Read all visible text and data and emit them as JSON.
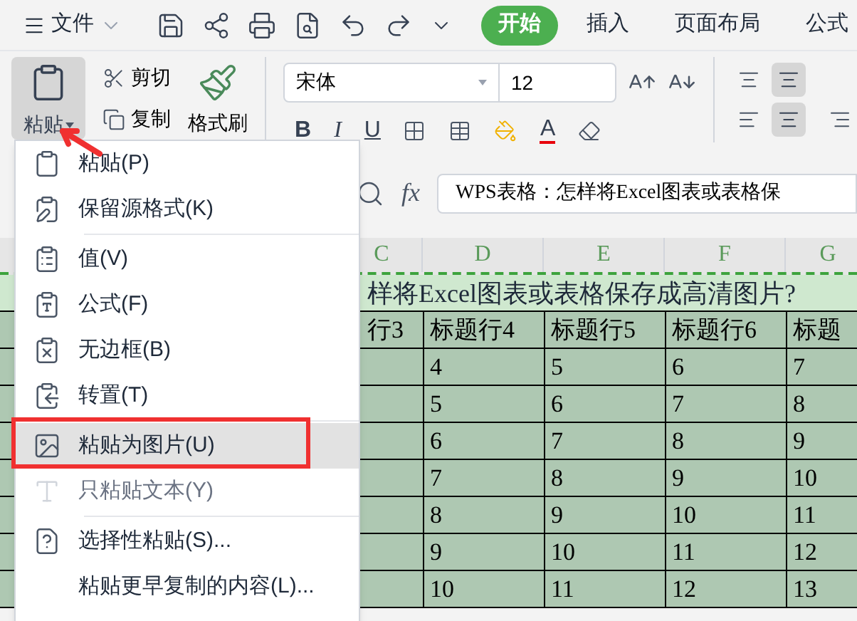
{
  "menu_bar": {
    "file_label": "文件",
    "tabs": [
      {
        "label": "开始",
        "selected": true
      },
      {
        "label": "插入",
        "selected": false
      },
      {
        "label": "页面布局",
        "selected": false
      },
      {
        "label": "公式",
        "selected": false
      }
    ]
  },
  "ribbon": {
    "paste_label": "粘贴",
    "paste_active": true,
    "cut_label": "剪切",
    "copy_label": "复制",
    "format_painter_label": "格式刷",
    "font": "宋体",
    "font_size": "12",
    "bold_letter": "B",
    "italic_letter": "I",
    "underline_letter": "U",
    "font_color_letter": "A"
  },
  "formula_bar": {
    "fx": "fx",
    "value": "WPS表格：怎样将Excel图表或表格保"
  },
  "sheet": {
    "columns": [
      "C",
      "D",
      "E",
      "F",
      "G"
    ],
    "title": "样将Excel图表或表格保存成高清图片?",
    "headers": [
      "行3",
      "标题行4",
      "标题行5",
      "标题行6",
      "标题"
    ],
    "rows": [
      [
        "",
        "4",
        "5",
        "6",
        "7"
      ],
      [
        "",
        "5",
        "6",
        "7",
        "8"
      ],
      [
        "",
        "6",
        "7",
        "8",
        "9"
      ],
      [
        "",
        "7",
        "8",
        "9",
        "10"
      ],
      [
        "",
        "8",
        "9",
        "10",
        "11"
      ],
      [
        "",
        "9",
        "10",
        "11",
        "12"
      ],
      [
        "",
        "10",
        "11",
        "12",
        "13"
      ]
    ]
  },
  "paste_menu": {
    "items": [
      {
        "kind": "item",
        "label": "粘贴(P)",
        "selected": false,
        "disabled": false
      },
      {
        "kind": "item",
        "label": "保留源格式(K)",
        "selected": false,
        "disabled": false
      },
      {
        "kind": "separator"
      },
      {
        "kind": "item",
        "label": "值(V)",
        "selected": false,
        "disabled": false
      },
      {
        "kind": "item",
        "label": "公式(F)",
        "selected": false,
        "disabled": false
      },
      {
        "kind": "item",
        "label": "无边框(B)",
        "selected": false,
        "disabled": false
      },
      {
        "kind": "item",
        "label": "转置(T)",
        "selected": false,
        "disabled": false
      },
      {
        "kind": "separator"
      },
      {
        "kind": "item",
        "label": "粘贴为图片(U)",
        "selected": true,
        "disabled": false
      },
      {
        "kind": "item",
        "label": "只粘贴文本(Y)",
        "selected": false,
        "disabled": true
      },
      {
        "kind": "separator"
      },
      {
        "kind": "item",
        "label": "选择性粘贴(S)...",
        "selected": false,
        "disabled": false
      },
      {
        "kind": "item",
        "label": "粘贴更早复制的内容(L)...",
        "selected": false,
        "disabled": false
      }
    ]
  }
}
